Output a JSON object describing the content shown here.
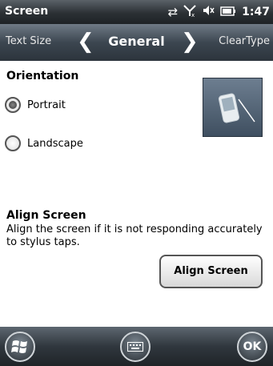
{
  "status": {
    "title": "Screen",
    "time": "1:47",
    "icons": [
      "sync-icon",
      "signal-off-icon",
      "speaker-muted-icon",
      "battery-icon"
    ]
  },
  "tabs": {
    "prev": "Text Size",
    "current": "General",
    "next": "ClearType"
  },
  "orientation": {
    "title": "Orientation",
    "options": [
      {
        "label": "Portrait",
        "selected": true
      },
      {
        "label": "Landscape",
        "selected": false
      }
    ]
  },
  "align": {
    "title": "Align Screen",
    "description": "Align the screen if it is not responding accurately to stylus taps.",
    "button_label": "Align Screen"
  },
  "bottombar": {
    "ok_label": "OK"
  }
}
